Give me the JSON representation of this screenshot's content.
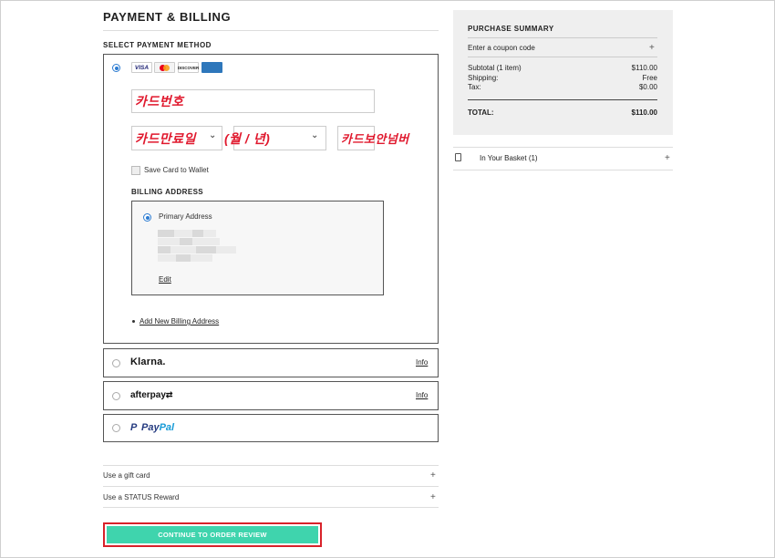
{
  "page": {
    "title": "PAYMENT & BILLING",
    "section_label": "SELECT PAYMENT METHOD"
  },
  "card": {
    "logos": [
      "VISA",
      "mastercard",
      "DISCOVER",
      "AMERICAN EXPRESS"
    ],
    "number_annotation": "카드번호",
    "expiry_annotation": "카드만료일",
    "expiry_format_annotation": "(월 / 년)",
    "cvv_annotation": "카드보안넘버",
    "save_card_label": "Save Card to Wallet"
  },
  "billing": {
    "heading": "BILLING ADDRESS",
    "primary_label": "Primary Address",
    "edit_label": "Edit",
    "add_new_label": "Add New Billing Address"
  },
  "methods": {
    "klarna": {
      "label": "Klarna.",
      "info": "Info"
    },
    "afterpay": {
      "label": "afterpay",
      "info": "Info"
    },
    "paypal": {
      "label_a": "Pay",
      "label_b": "Pal"
    }
  },
  "extras": {
    "gift_card": "Use a gift card",
    "status_reward": "Use a STATUS Reward"
  },
  "cta": {
    "label": "CONTINUE TO ORDER REVIEW"
  },
  "summary": {
    "title": "PURCHASE SUMMARY",
    "coupon": "Enter a coupon code",
    "subtotal_label": "Subtotal (1 item)",
    "subtotal_value": "$110.00",
    "shipping_label": "Shipping:",
    "shipping_value": "Free",
    "tax_label": "Tax:",
    "tax_value": "$0.00",
    "total_label": "TOTAL:",
    "total_value": "$110.00"
  },
  "basket": {
    "label": "In Your Basket (1)"
  },
  "symbols": {
    "plus": "+",
    "chevron": "⌄"
  },
  "colors": {
    "accent_radio": "#2b7bd1",
    "cta": "#3fd4ad",
    "annotation_red": "#e0182d",
    "highlight": "#d8222a"
  }
}
